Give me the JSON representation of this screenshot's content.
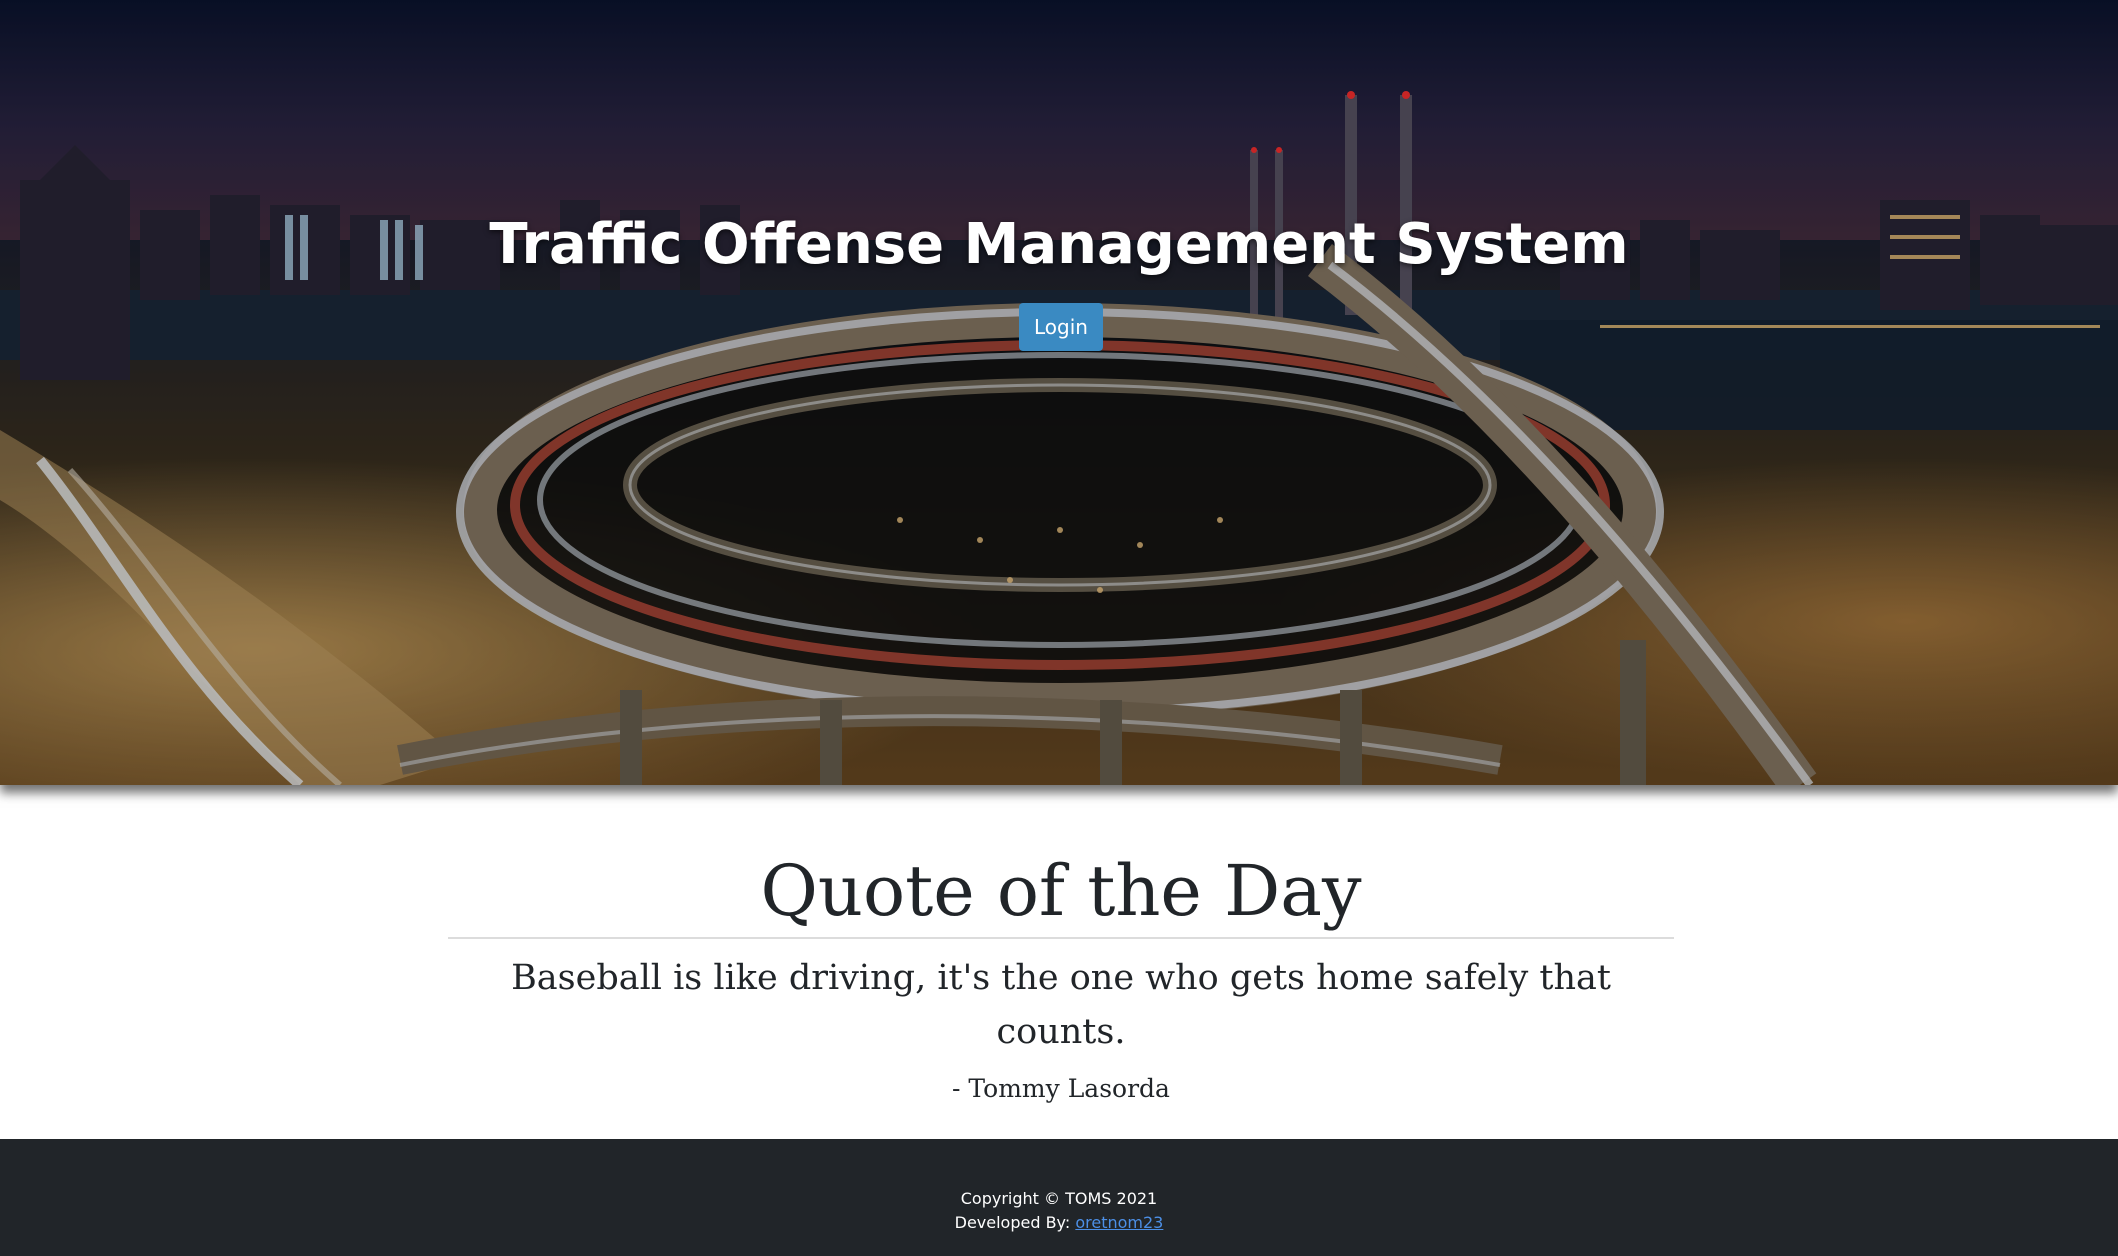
{
  "hero": {
    "title": "Traffic Offense Management System",
    "login_label": "Login",
    "background_image": "city-highway-night-photo"
  },
  "quote": {
    "heading": "Quote of the Day",
    "text": "Baseball is like driving, it's the one who gets home safely that counts.",
    "author": "- Tommy Lasorda"
  },
  "footer": {
    "copyright": "Copyright © TOMS 2021",
    "developed_by_label": "Developed By:",
    "developer_name": "oretnom23"
  },
  "colors": {
    "login_button": "#3a8ac2",
    "footer_bg": "#212529",
    "link": "#4c8fe6",
    "text": "#212529"
  }
}
